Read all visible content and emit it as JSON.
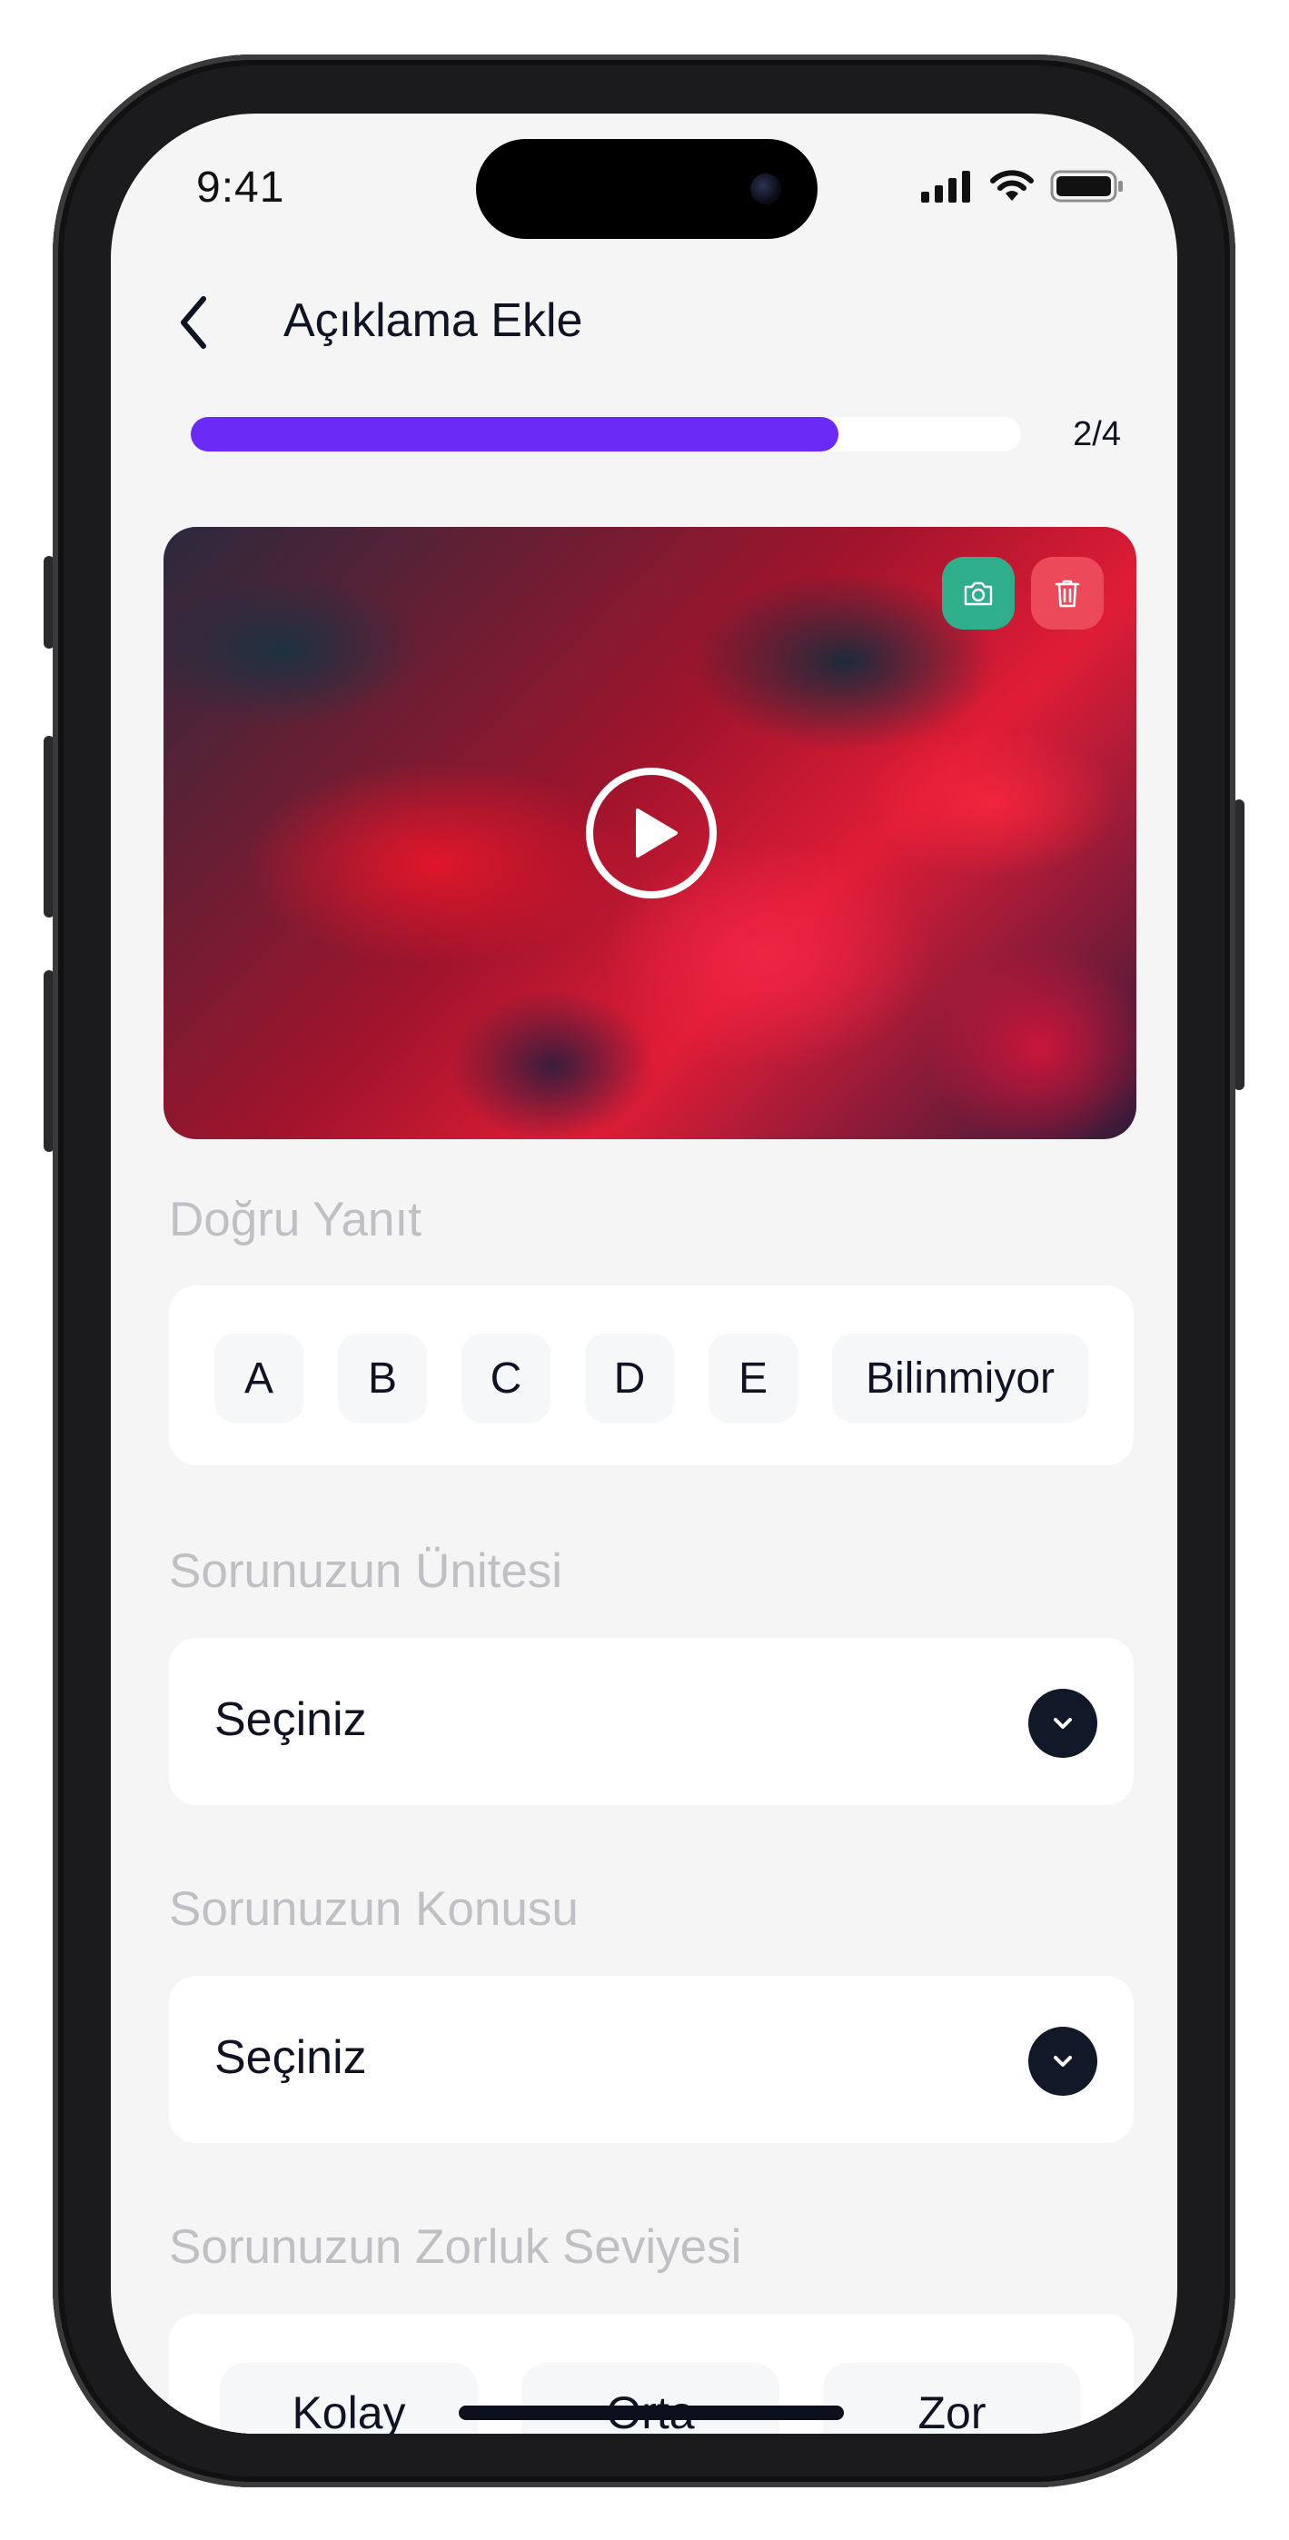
{
  "status_bar": {
    "time": "9:41"
  },
  "header": {
    "title": "Açıklama Ekle"
  },
  "progress": {
    "label": "2/4",
    "fraction": 0.78
  },
  "video": {
    "camera_icon": "camera-icon",
    "delete_icon": "trash-icon",
    "play_icon": "play-circle-icon"
  },
  "answer": {
    "label": "Doğru Yanıt",
    "options": [
      "A",
      "B",
      "C",
      "D",
      "E",
      "Bilinmiyor"
    ]
  },
  "unit": {
    "label": "Sorunuzun Ünitesi",
    "value": "Seçiniz"
  },
  "topic": {
    "label": "Sorunuzun Konusu",
    "value": "Seçiniz"
  },
  "difficulty": {
    "label": "Sorunuzun Zorluk Seviyesi",
    "options": [
      "Kolay",
      "Orta",
      "Zor"
    ]
  },
  "colors": {
    "accent": "#6b2af5",
    "camera_btn": "#2fae8c",
    "delete_btn": "#ec4a5a",
    "dark": "#111827"
  }
}
